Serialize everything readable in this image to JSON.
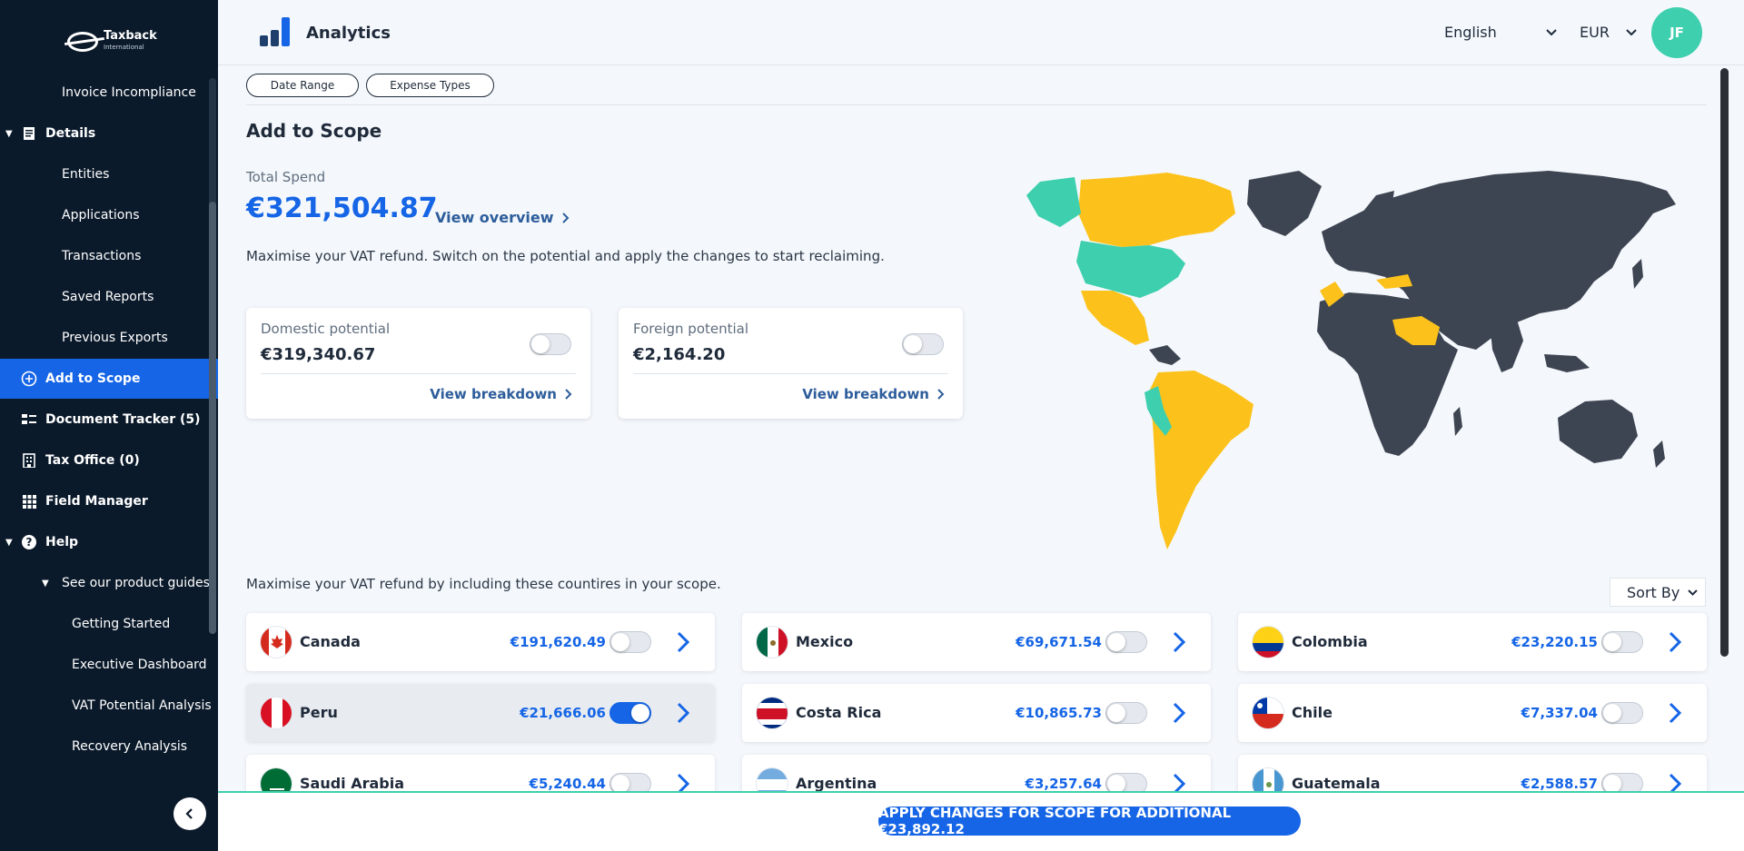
{
  "sidebar": {
    "logo_text": "Taxback",
    "logo_subtext": "International",
    "items": [
      {
        "label": "Invoice Incompliance"
      },
      {
        "label": "Details"
      },
      {
        "label": "Entities"
      },
      {
        "label": "Applications"
      },
      {
        "label": "Transactions"
      },
      {
        "label": "Saved Reports"
      },
      {
        "label": "Previous Exports"
      },
      {
        "label": "Add to Scope"
      },
      {
        "label": "Document Tracker (5)"
      },
      {
        "label": "Tax Office (0)"
      },
      {
        "label": "Field Manager"
      },
      {
        "label": "Help"
      },
      {
        "label": "See our product guides"
      },
      {
        "label": "Getting Started"
      },
      {
        "label": "Executive Dashboard"
      },
      {
        "label": "VAT Potential Analysis"
      },
      {
        "label": "Recovery Analysis"
      }
    ]
  },
  "header": {
    "title": "Analytics",
    "language": "English",
    "currency": "EUR",
    "avatar_initials": "JF"
  },
  "filters": {
    "date_range": "Date Range",
    "expense_types": "Expense Types"
  },
  "main": {
    "title": "Add to Scope",
    "total_label": "Total Spend",
    "total_value": "€321,504.87",
    "view_overview": "View overview",
    "intro": "Maximise your VAT refund. Switch on the potential and apply the changes to start reclaiming.",
    "domestic": {
      "label": "Domestic potential",
      "value": "€319,340.67",
      "link": "View breakdown",
      "toggle_on": false
    },
    "foreign": {
      "label": "Foreign potential",
      "value": "€2,164.20",
      "link": "View breakdown",
      "toggle_on": false
    },
    "countries_intro": "Maximise your VAT refund by including these countires in your scope.",
    "sort_label": "Sort By",
    "map_colors": {
      "scope": "#3ecfae",
      "potential": "#fcc21b",
      "other": "#3e4552"
    }
  },
  "countries": [
    {
      "name": "Canada",
      "value": "€191,620.49",
      "on": false
    },
    {
      "name": "Mexico",
      "value": "€69,671.54",
      "on": false
    },
    {
      "name": "Colombia",
      "value": "€23,220.15",
      "on": false
    },
    {
      "name": "Peru",
      "value": "€21,666.06",
      "on": true
    },
    {
      "name": "Costa Rica",
      "value": "€10,865.73",
      "on": false
    },
    {
      "name": "Chile",
      "value": "€7,337.04",
      "on": false
    },
    {
      "name": "Saudi Arabia",
      "value": "€5,240.44",
      "on": false
    },
    {
      "name": "Argentina",
      "value": "€3,257.64",
      "on": false
    },
    {
      "name": "Guatemala",
      "value": "€2,588.57",
      "on": false
    }
  ],
  "apply_label": "APPLY CHANGES FOR SCOPE FOR ADDITIONAL €23,892.12"
}
